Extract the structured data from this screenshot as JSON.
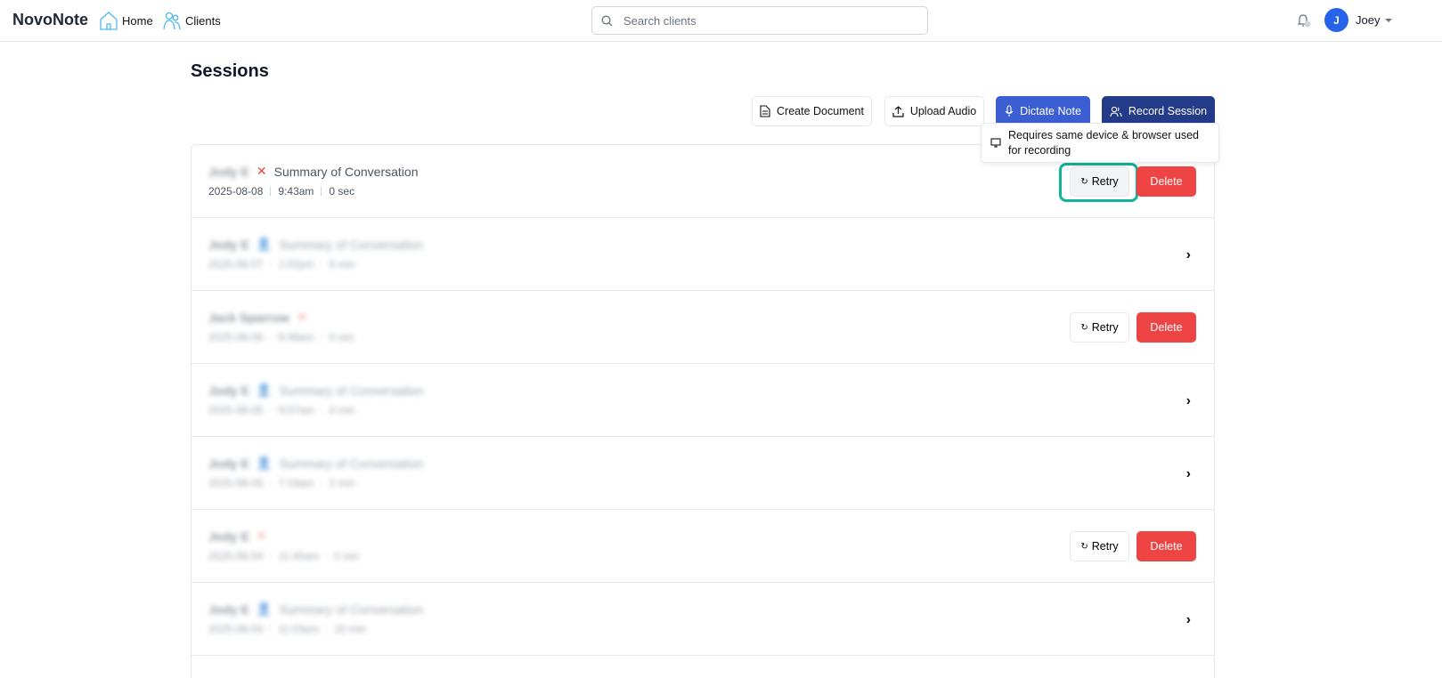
{
  "header": {
    "logo": "NovoNote",
    "nav": [
      {
        "label": "Home",
        "icon": "home-icon"
      },
      {
        "label": "Clients",
        "icon": "users-icon"
      }
    ],
    "search_placeholder": "Search clients",
    "user_initial": "J",
    "user_name": "Joey"
  },
  "page": {
    "title": "Sessions"
  },
  "toolbar": {
    "create_document": "Create Document",
    "upload_audio": "Upload Audio",
    "dictate_note": "Dictate Note",
    "record_session": "Record Session"
  },
  "tooltip": "Requires same device & browser used for recording",
  "colors": {
    "dictate": "#3b5fd3",
    "record": "#243b8a",
    "delete": "#ef4444",
    "highlight": "#10b39a"
  },
  "sessions": [
    {
      "name": "Jody E",
      "status": "failed",
      "title": "Summary of Conversation",
      "date": "2025-08-08",
      "time": "9:43am",
      "duration": "0 sec",
      "actions": [
        "Retry",
        "Delete"
      ],
      "blurred_name": true
    },
    {
      "name": "Jody E",
      "status": "user",
      "title": "Summary of Conversation",
      "date": "2025-08-07",
      "time": "1:02pm",
      "duration": "6 min",
      "blurred": true
    },
    {
      "name": "Jack Sparrow",
      "status": "failed",
      "title": "",
      "date": "2025-08-06",
      "time": "9:48am",
      "duration": "0 sec",
      "actions": [
        "Retry",
        "Delete"
      ],
      "blurred": true
    },
    {
      "name": "Jody E",
      "status": "user",
      "title": "Summary of Conversation",
      "date": "2025-08-05",
      "time": "9:07am",
      "duration": "4 min",
      "blurred": true
    },
    {
      "name": "Jody E",
      "status": "user",
      "title": "Summary of Conversation",
      "date": "2025-08-05",
      "time": "7:19am",
      "duration": "2 min",
      "blurred": true
    },
    {
      "name": "Jody E",
      "status": "failed",
      "title": "",
      "date": "2025-08-04",
      "time": "11:45am",
      "duration": "0 sec",
      "actions": [
        "Retry",
        "Delete"
      ],
      "blurred": true
    },
    {
      "name": "Jody E",
      "status": "user",
      "title": "Summary of Conversation",
      "date": "2025-08-04",
      "time": "11:03am",
      "duration": "10 min",
      "blurred": true
    }
  ]
}
